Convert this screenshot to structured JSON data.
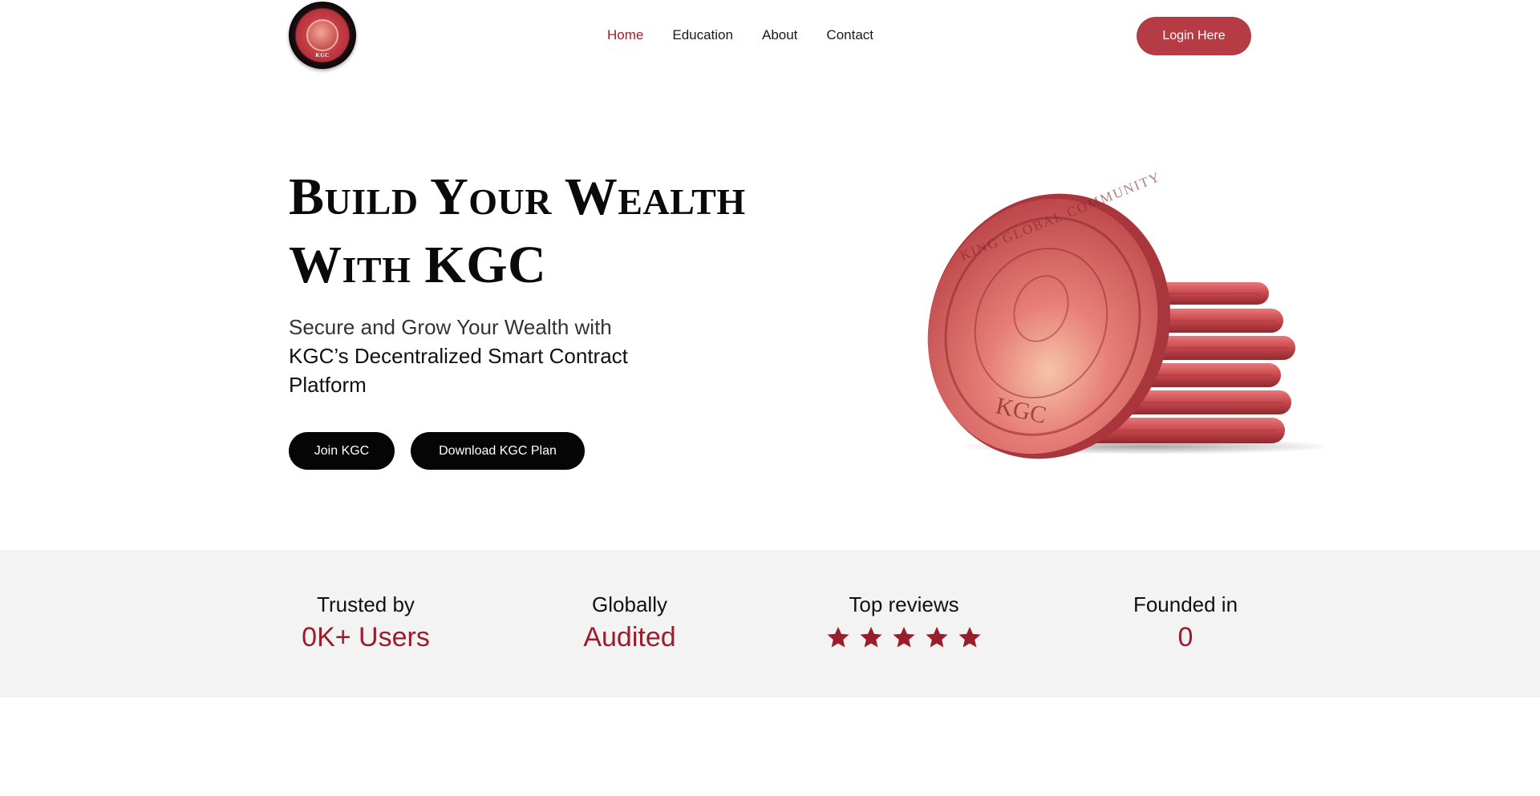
{
  "brand": {
    "logo_text": "KGC"
  },
  "nav": {
    "items": [
      {
        "label": "Home",
        "active": true
      },
      {
        "label": "Education",
        "active": false
      },
      {
        "label": "About",
        "active": false
      },
      {
        "label": "Contact",
        "active": false
      }
    ],
    "login_label": "Login Here"
  },
  "hero": {
    "title_line1": "Build Your Wealth",
    "title_line2": "With KGC",
    "subtitle_light": "Secure and Grow Your Wealth with",
    "subtitle_main": "KGC’s Decentralized Smart Contract Platform",
    "join_label": "Join KGC",
    "download_label": "Download KGC Plan",
    "coin_text_top": "KING GLOBAL COMMUNITY",
    "coin_text_bottom": "KGC"
  },
  "stats": [
    {
      "label": "Trusted by",
      "value": "0K+ Users"
    },
    {
      "label": "Globally",
      "value": "Audited"
    },
    {
      "label": "Top reviews",
      "stars": 5
    },
    {
      "label": "Founded in",
      "value": "0"
    }
  ],
  "colors": {
    "accent": "#9b1c2a",
    "button_primary": "#b53c45",
    "button_dark": "#050505",
    "band_bg": "#f3f3f3"
  }
}
